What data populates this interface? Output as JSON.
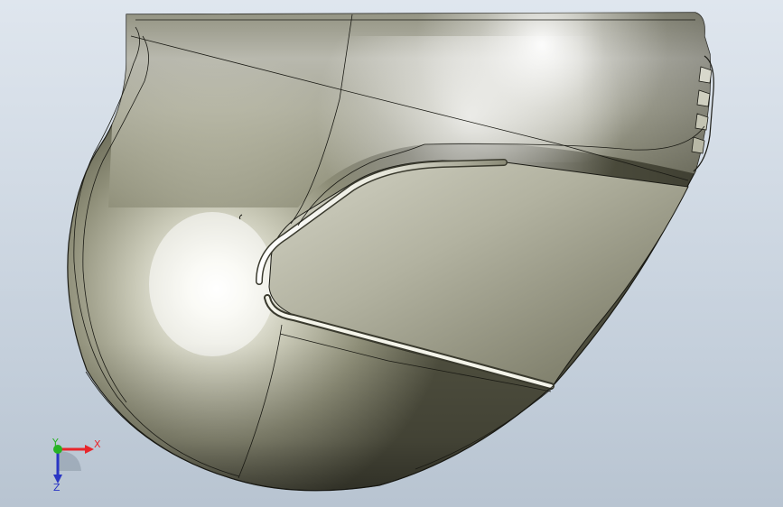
{
  "scene": {
    "background_top": "#dfe6ee",
    "background_bottom": "#b8c4d1",
    "model_base_color": "#9a9a84",
    "model_highlight": "#ffffff",
    "model_shadow": "#5e5e4c",
    "edge_color": "#1a1a14"
  },
  "triad": {
    "x_label": "X",
    "y_label": "Y",
    "z_label": "Z",
    "x_color": "#e8262b",
    "y_color": "#27b324",
    "z_color": "#2a36c4"
  }
}
